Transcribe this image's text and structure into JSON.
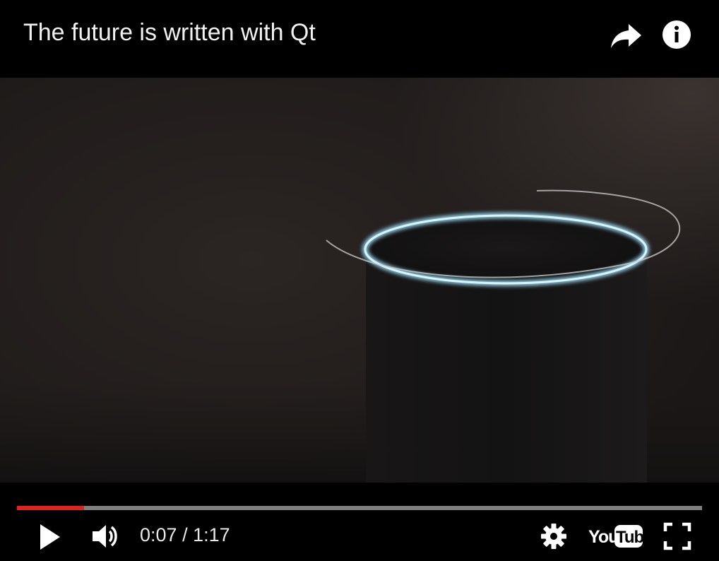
{
  "header": {
    "title": "The future is written with Qt",
    "share_icon": "share-arrow-icon",
    "info_icon": "info-icon"
  },
  "video": {
    "frame_description_icon": "smart-speaker-with-glowing-ring"
  },
  "controls": {
    "progress_fraction": 0.098,
    "current_time": "0:07",
    "separator": " / ",
    "duration": "1:17",
    "time_label": "0:07 / 1:17",
    "play_icon": "play-icon",
    "volume_icon": "volume-icon",
    "settings_icon": "gear-icon",
    "logo_icon": "youtube-logo",
    "fullscreen_icon": "fullscreen-icon",
    "logo_text_left": "You",
    "logo_text_right": "Tube"
  },
  "colors": {
    "progress_played": "#e1241b",
    "progress_track": "#7f7f7f",
    "ring_glow": "#9fe3ff",
    "background": "#000000"
  }
}
